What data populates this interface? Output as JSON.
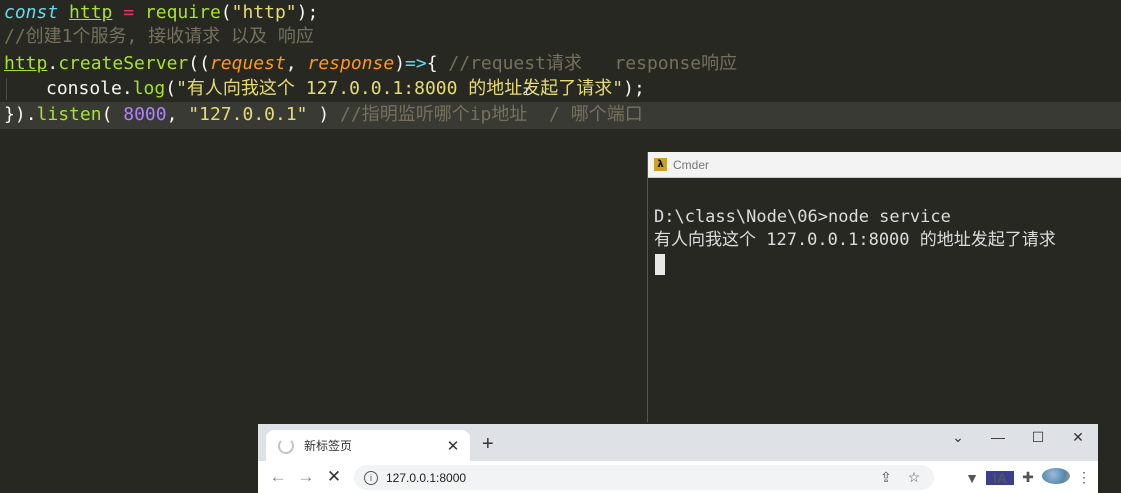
{
  "editor": {
    "line1": {
      "kw_const": "const",
      "var_http": "http",
      "op_eq": "=",
      "fn_require": "require",
      "paren_open": "(",
      "str_http": "\"http\"",
      "paren_close_semi": ");"
    },
    "line2": {
      "comment": "//创建1个服务, 接收请求 以及 响应"
    },
    "line3": {
      "var_http": "http",
      "dot": ".",
      "fn_createServer": "createServer",
      "paren_open2": "((",
      "param_request": "request",
      "comma": ", ",
      "param_response": "response",
      "paren_close": ")",
      "arrow": "=>",
      "brace_open": "{ ",
      "comment": "//request请求   response响应"
    },
    "line4": {
      "console": "console",
      "dot": ".",
      "fn_log": "log",
      "paren_open": "(",
      "str_message": "\"有人向我这个 127.0.0.1:8000 的地址发起了请求\"",
      "paren_close_semi": ");"
    },
    "line5": {
      "close": "})",
      "dot": ".",
      "fn_listen": "listen",
      "paren_open": "( ",
      "num_port": "8000",
      "comma": ", ",
      "str_host": "\"127.0.0.1\"",
      "paren_close": " ) ",
      "comment": "//指明监听哪个ip地址  / 哪个端口"
    }
  },
  "cmder": {
    "title": "Cmder",
    "logo": "λ",
    "lines": [
      "D:\\class\\Node\\06>node service",
      "有人向我这个 127.0.0.1:8000 的地址发起了请求"
    ]
  },
  "browser": {
    "tab_title": "新标签页",
    "tab_close": "✕",
    "new_tab": "+",
    "window_controls": {
      "tab_search": "⌄",
      "minimize": "—",
      "maximize": "☐",
      "close": "✕"
    },
    "nav": {
      "back": "←",
      "forward": "→",
      "stop": "✕"
    },
    "url": "127.0.0.1:8000",
    "icons": {
      "info": "i",
      "share": "⇪",
      "star": "☆",
      "ext_v": "▼",
      "ext_ia": "IA",
      "puzzle": "✚",
      "menu": "⋮"
    }
  }
}
